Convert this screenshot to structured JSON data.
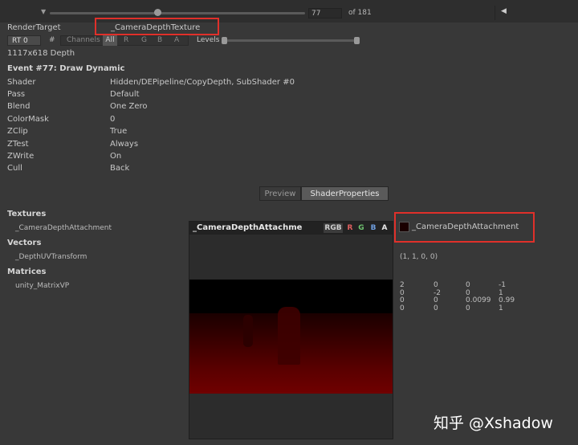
{
  "topbar": {
    "frame_index": "77",
    "frame_total": "of 181",
    "prev_glyph": "◀",
    "down_glyph": "▼"
  },
  "render_target": {
    "label": "RenderTarget",
    "value": "_CameraDepthTexture"
  },
  "toolbar": {
    "rt_select": "RT 0",
    "hash": "#",
    "channels_label": "Channels",
    "channel_all": "All",
    "channel_r": "R",
    "channel_g": "G",
    "channel_b": "B",
    "channel_a": "A",
    "levels_label": "Levels"
  },
  "resolution": "1117x618 Depth",
  "event_title": "Event #77: Draw Dynamic",
  "details": [
    {
      "label": "Shader",
      "value": "Hidden/DEPipeline/CopyDepth, SubShader #0"
    },
    {
      "label": "Pass",
      "value": "Default"
    },
    {
      "label": "Blend",
      "value": "One Zero"
    },
    {
      "label": "ColorMask",
      "value": "0"
    },
    {
      "label": "ZClip",
      "value": "True"
    },
    {
      "label": "ZTest",
      "value": "Always"
    },
    {
      "label": "ZWrite",
      "value": "On"
    },
    {
      "label": "Cull",
      "value": "Back"
    }
  ],
  "tabs": {
    "preview": "Preview",
    "shader_properties": "ShaderProperties"
  },
  "textures": {
    "section": "Textures",
    "prop_name": "_CameraDepthAttachment",
    "preview_title": "_CameraDepthAttachme",
    "ch_rgb": "RGB",
    "ch_r": "R",
    "ch_g": "G",
    "ch_b": "B",
    "ch_a": "A",
    "value_name": "_CameraDepthAttachment"
  },
  "vectors": {
    "section": "Vectors",
    "prop_name": "_DepthUVTransform",
    "value": "(1, 1, 0, 0)"
  },
  "matrices": {
    "section": "Matrices",
    "prop_name": "unity_MatrixVP",
    "rows": [
      [
        "2",
        "0",
        "0",
        "-1"
      ],
      [
        "0",
        "-2",
        "0",
        "1"
      ],
      [
        "0",
        "0",
        "0.0099",
        "0.99"
      ],
      [
        "0",
        "0",
        "0",
        "1"
      ]
    ]
  },
  "colors": {
    "highlight": "#e0302a",
    "red_channel": "#e06060",
    "green_channel": "#6fc36f",
    "blue_channel": "#6f9fe0"
  },
  "watermark": "知乎 @Xshadow"
}
